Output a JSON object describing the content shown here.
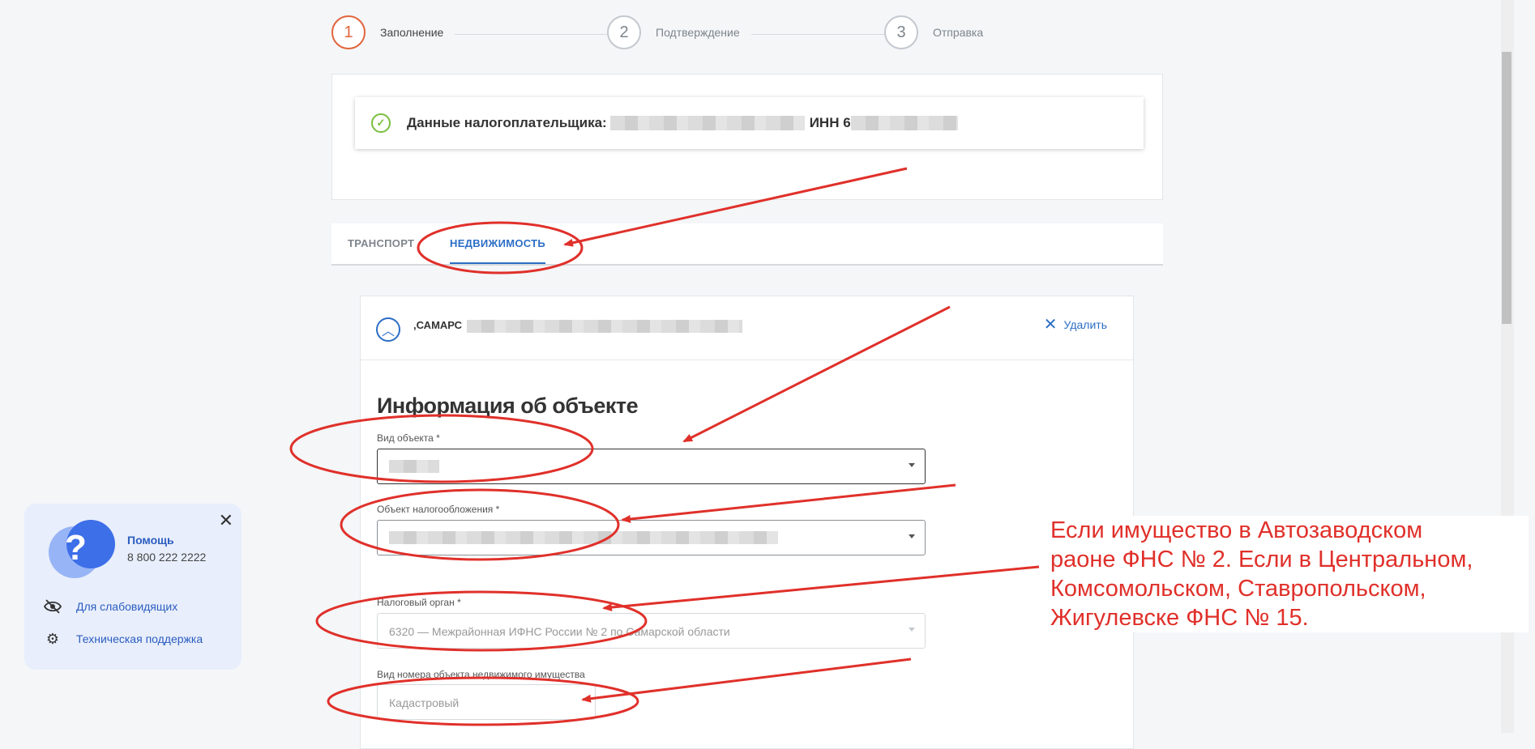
{
  "stepper": {
    "steps": [
      {
        "num": "1",
        "label": "Заполнение"
      },
      {
        "num": "2",
        "label": "Подтверждение"
      },
      {
        "num": "3",
        "label": "Отправка"
      }
    ]
  },
  "taxpayer": {
    "label": "Данные налогоплательщика:",
    "inn_label": "ИНН 6"
  },
  "tabs": {
    "transport": "ТРАНСПОРТ",
    "realty": "НЕДВИЖИМОСТЬ"
  },
  "object": {
    "address_prefix": ",САМАРС",
    "delete_label": "Удалить",
    "section_title": "Информация об объекте",
    "fields": {
      "type_label": "Вид объекта *",
      "tax_object_label": "Объект налогообложения *",
      "tax_authority_label": "Налоговый орган *",
      "tax_authority_value": "6320 — Межрайонная ИФНС России № 2 по Самарской области",
      "number_type_label": "Вид номера объекта недвижимого имущества",
      "number_type_value": "Кадастровый"
    }
  },
  "help": {
    "title": "Помощь",
    "phone": "8 800 222 2222",
    "visually_impaired": "Для слабовидящих",
    "support": "Техническая поддержка"
  },
  "annotation": {
    "note_lines": [
      "Если имущество в Автозаводском",
      "раоне ФНС № 2. Если в Центральном,",
      "Комсомольском, Ставропольском,",
      "Жигулевске ФНС № 15."
    ],
    "color": "#e0302a"
  },
  "colors": {
    "accent_blue": "#2b6ec6",
    "step_active": "#e2643c",
    "success": "#78be3c"
  }
}
